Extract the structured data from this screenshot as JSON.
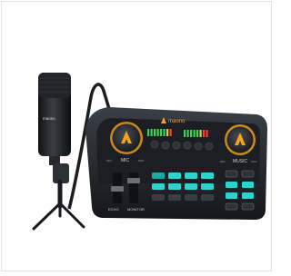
{
  "product_image": {
    "brand_text": "maono",
    "microphone_brand_text": "maono",
    "knob_labels": {
      "left": "MIC",
      "right": "MUSIC"
    },
    "small_labels": {
      "left_min": "MIN",
      "left_max": "MAX",
      "right_min": "MIN",
      "right_max": "MAX"
    },
    "fader_labels": {
      "echo": "ECHO",
      "monitor": "MONITOR"
    },
    "colors": {
      "body": "#2a2d33",
      "panel": "#1b1d22",
      "accent_orange": "#f2a41f",
      "pad_teal": "#29d6cf",
      "pad_teal_dark": "#1aa9a4",
      "led_green": "#39d353",
      "led_red": "#ff3b30"
    }
  }
}
